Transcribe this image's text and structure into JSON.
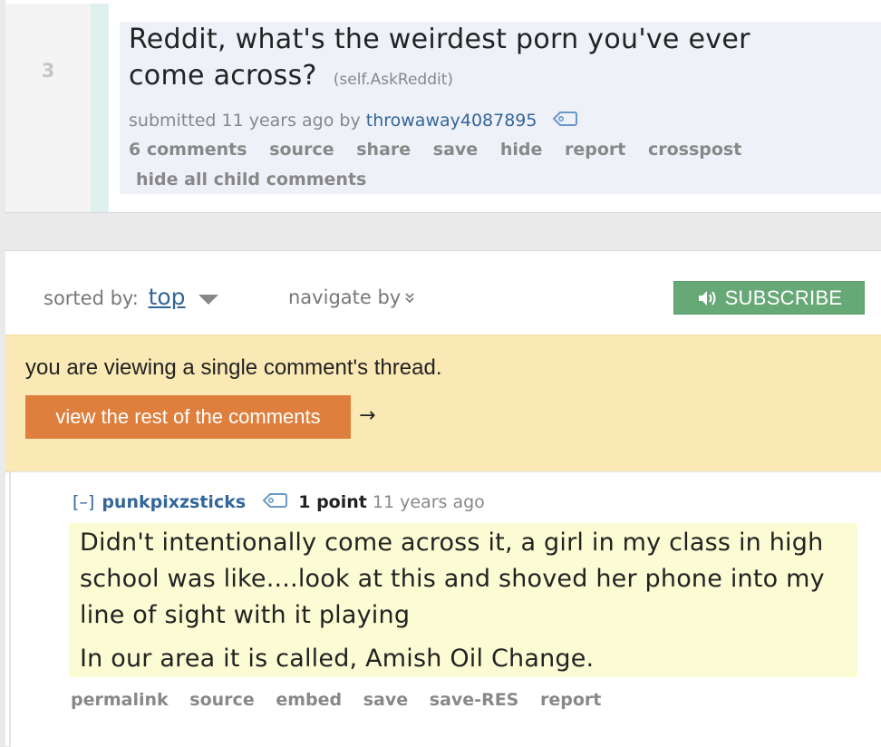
{
  "post": {
    "rank": "3",
    "title": "Reddit, what's the weirdest porn you've ever come across?",
    "domain": "(self.AskReddit)",
    "submitted_prefix": "submitted 11 years ago by",
    "author": "throwaway4087895",
    "buttons": [
      "6 comments",
      "source",
      "share",
      "save",
      "hide",
      "report",
      "crosspost"
    ],
    "hide_children": "hide all child comments"
  },
  "menu": {
    "sorted_by_label": "sorted by:",
    "sorted_by_value": "top",
    "navigate_label": "navigate by",
    "subscribe_label": "SUBSCRIBE"
  },
  "thread_notice": {
    "text": "you are viewing a single comment's thread.",
    "view_rest_label": "view the rest of the comments",
    "arrow": "→"
  },
  "comment": {
    "collapse": "[–]",
    "author": "punkpixzsticks",
    "score": "1 point",
    "time": "11 years ago",
    "paragraphs": [
      "Didn't intentionally come across it, a girl in my class in high school was like....look at this and shoved her phone into my line of sight with it playing",
      "In our area it is called, Amish Oil Change."
    ],
    "buttons": [
      "permalink",
      "source",
      "embed",
      "save",
      "save-RES",
      "report"
    ]
  },
  "colors": {
    "link": "#336699",
    "subscribe": "#67a877",
    "view_rest": "#de7f3d",
    "notice_bg": "#fbe9b5",
    "comment_bg": "#fcfcd4"
  }
}
